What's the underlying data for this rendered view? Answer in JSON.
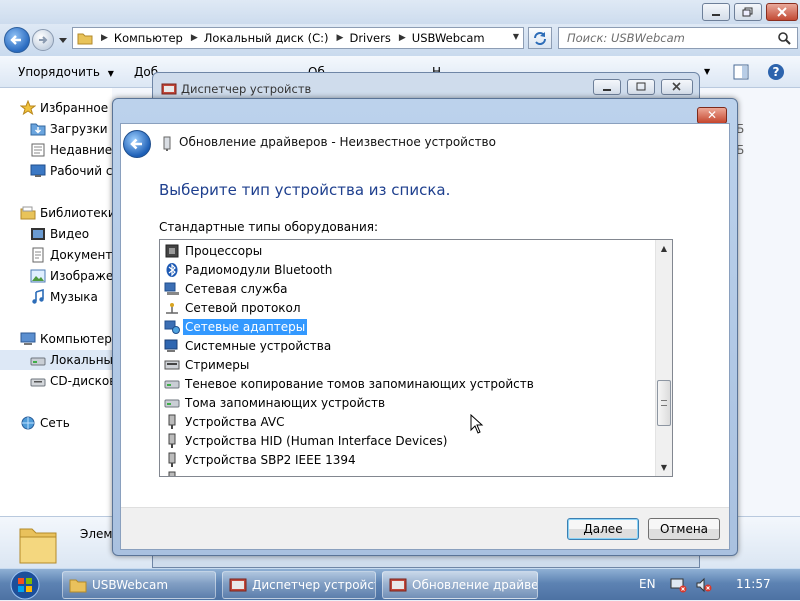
{
  "explorer": {
    "address_segments": [
      "Компьютер",
      "Локальный диск (C:)",
      "Drivers",
      "USBWebcam"
    ],
    "search_placeholder": "Поиск: USBWebcam",
    "toolbar": {
      "organize_label": "Упорядочить",
      "partial_1": "Доб",
      "partial_2": "Об",
      "partial_3": "Н"
    },
    "sidebar": {
      "favorites": "Избранное",
      "downloads": "Загрузки",
      "recent": "Недавние м",
      "desktop": "Рабочий ст",
      "libraries": "Библиотеки",
      "video": "Видео",
      "documents": "Документы",
      "images": "Изображен",
      "music": "Музыка",
      "computer": "Компьютер",
      "local_disk": "Локальный",
      "cd_drive": "CD-дисков",
      "network": "Сеть"
    },
    "right_partial_1": "Б",
    "right_partial_2": "Б",
    "details_label": "Элем"
  },
  "devmgr": {
    "title": "Диспетчер устройств"
  },
  "wizard": {
    "title": "Обновление драйверов - Неизвестное устройство",
    "close_glyph": "✕",
    "heading": "Выберите тип устройства из списка.",
    "list_label": "Стандартные типы оборудования:",
    "items": [
      {
        "label": "Процессоры",
        "icon": "processor-icon"
      },
      {
        "label": "Радиомодули Bluetooth",
        "icon": "bluetooth-icon"
      },
      {
        "label": "Сетевая служба",
        "icon": "network-service-icon"
      },
      {
        "label": "Сетевой протокол",
        "icon": "network-protocol-icon"
      },
      {
        "label": "Сетевые адаптеры",
        "icon": "network-adapter-icon",
        "selected": true
      },
      {
        "label": "Системные устройства",
        "icon": "system-device-icon"
      },
      {
        "label": "Стримеры",
        "icon": "tape-drive-icon"
      },
      {
        "label": "Теневое копирование томов запоминающих устройств",
        "icon": "shadow-copy-icon"
      },
      {
        "label": "Тома запоминающих устройств",
        "icon": "storage-volume-icon"
      },
      {
        "label": "Устройства AVC",
        "icon": "avc-device-icon"
      },
      {
        "label": "Устройства HID (Human Interface Devices)",
        "icon": "hid-device-icon"
      },
      {
        "label": "Устройства SBP2 IEEE 1394",
        "icon": "sbp2-device-icon"
      }
    ],
    "next_label": "Далее",
    "cancel_label": "Отмена"
  },
  "taskbar": {
    "items": [
      {
        "label": "USBWebcam",
        "icon": "folder-icon"
      },
      {
        "label": "Диспетчер устройств",
        "icon": "device-manager-icon"
      },
      {
        "label": "Обновление драйве...",
        "icon": "device-manager-icon",
        "active": true
      }
    ],
    "language": "EN",
    "clock": "11:57"
  },
  "colors": {
    "selection": "#3399ff",
    "heading_blue": "#1e3f8e",
    "taskbar": "#5d83b3"
  }
}
